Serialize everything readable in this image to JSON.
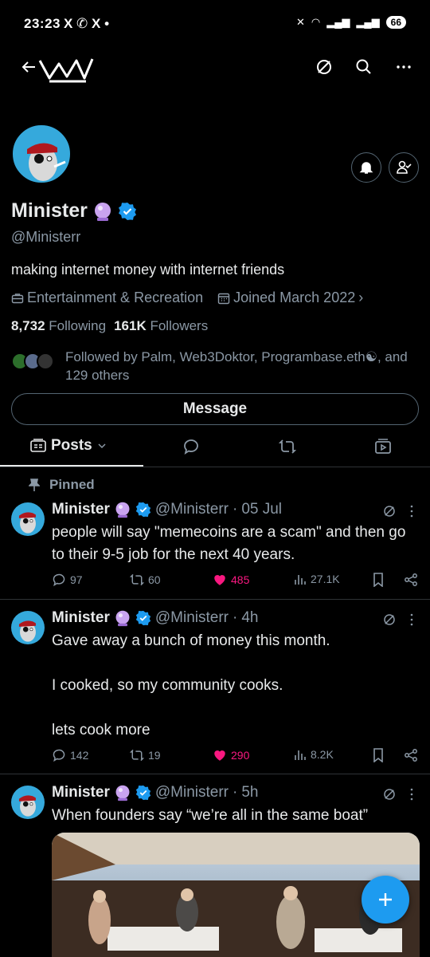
{
  "status_bar": {
    "time": "23:23",
    "left_icons": "X ✆ X •",
    "battery": "66"
  },
  "profile": {
    "name": "Minister",
    "handle": "@Ministerr",
    "bio": "making internet money with internet friends",
    "category": "Entertainment & Recreation",
    "joined": "Joined March 2022",
    "following_count": "8,732",
    "following_label": "Following",
    "followers_count": "161K",
    "followers_label": "Followers",
    "followed_by": "Followed by Palm, Web3Doktor, Programbase.eth☯, and 129 others",
    "message_label": "Message"
  },
  "tabs": {
    "posts_label": "Posts"
  },
  "pinned_label": "Pinned",
  "posts": [
    {
      "name": "Minister",
      "handle": "@Ministerr",
      "time": "05 Jul",
      "text": "people will say \"memecoins are a scam\" and then go to their 9-5 job for the next 40 years.",
      "replies": "97",
      "reposts": "60",
      "likes": "485",
      "views": "27.1K"
    },
    {
      "name": "Minister",
      "handle": "@Ministerr",
      "time": "4h",
      "text": "Gave away a bunch of money this month.\n\nI cooked, so my community cooks.\n\nlets cook more",
      "replies": "142",
      "reposts": "19",
      "likes": "290",
      "views": "8.2K"
    },
    {
      "name": "Minister",
      "handle": "@Ministerr",
      "time": "5h",
      "text": "When founders say “we’re all in the same boat”"
    }
  ],
  "colors": {
    "accent": "#1d9bf0",
    "like": "#f91880",
    "muted": "#8b98a5",
    "background": "#000000"
  }
}
